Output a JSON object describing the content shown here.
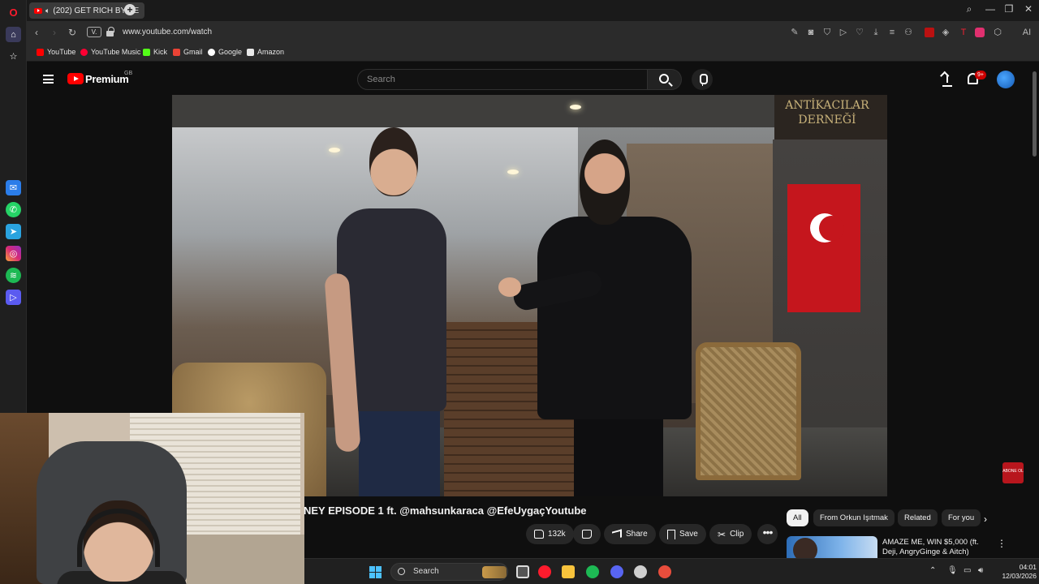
{
  "browser": {
    "tab_title": "(202) GET RICH BY SE",
    "url": "www.youtube.com/watch",
    "v_badge": "V.",
    "ai_label": "AI",
    "bookmarks": [
      {
        "label": "YouTube",
        "color": "#ff0000"
      },
      {
        "label": "YouTube Music",
        "color": "#ff0033"
      },
      {
        "label": "Kick",
        "color": "#53fc18"
      },
      {
        "label": "Gmail",
        "color": "#ea4335"
      },
      {
        "label": "Google",
        "color": "#4285f4"
      },
      {
        "label": "Amazon",
        "color": "#ffffff"
      }
    ],
    "sidebar_apps": [
      "messenger-icon",
      "whatsapp-icon",
      "telegram-icon",
      "instagram-icon",
      "spotify-icon",
      "player-icon"
    ]
  },
  "youtube": {
    "logo_text": "Premium",
    "logo_sup": "GB",
    "search_placeholder": "Search",
    "notif_count": "9+",
    "video_title": "NEY EPISODE 1 ft. @mahsunkaracа @EfeUygaçYoutube",
    "likes": "132k",
    "share_label": "Share",
    "save_label": "Save",
    "clip_label": "Clip",
    "more_label": "•••",
    "chips": [
      "All",
      "From Orkun Işıtmak",
      "Related",
      "For you"
    ],
    "recommended": {
      "title": "AMAZE ME, WIN $5,000 (ft. Deji, AngryGinge & Aitch)"
    },
    "video_sign": "ANTİKACILAR DERNEĞİ",
    "subscribe_badge": "ABONE OL"
  },
  "taskbar": {
    "search_label": "Search",
    "time": "04:01",
    "date": "12/03/2026"
  },
  "colors": {
    "accent": "#ff0000",
    "background": "#0f0f0f",
    "windows_blue": "#4cc2ff"
  }
}
